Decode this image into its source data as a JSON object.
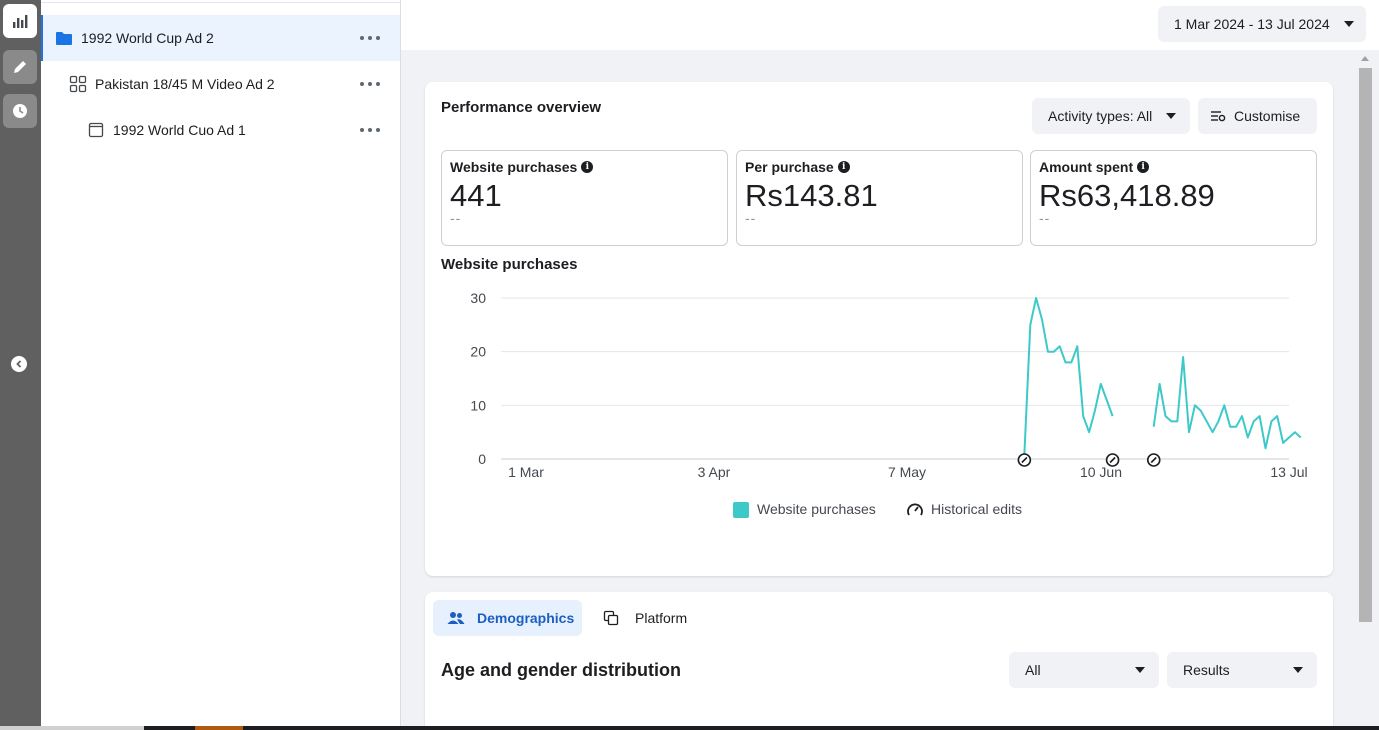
{
  "tree": {
    "items": [
      {
        "label": "1992 World Cup Ad 2",
        "icon": "folder-icon"
      },
      {
        "label": "Pakistan 18/45 M Video Ad 2",
        "icon": "grid-icon"
      },
      {
        "label": "1992 World Cuo Ad 1",
        "icon": "ad-icon"
      }
    ]
  },
  "header": {
    "date_range": "1 Mar 2024 - 13 Jul 2024"
  },
  "performance": {
    "title": "Performance overview",
    "activity_label": "Activity types: All",
    "customise_label": "Customise",
    "metrics": [
      {
        "label": "Website purchases",
        "value": "441",
        "delta": "--"
      },
      {
        "label": "Per purchase",
        "value": "Rs143.81",
        "delta": "--"
      },
      {
        "label": "Amount spent",
        "value": "Rs63,418.89",
        "delta": "--"
      }
    ],
    "chart_title": "Website purchases",
    "legend": {
      "series": "Website purchases",
      "edits": "Historical edits"
    }
  },
  "chart_data": {
    "type": "line",
    "title": "Website purchases",
    "xlabel": "",
    "ylabel": "",
    "ylim": [
      0,
      30
    ],
    "yticks": [
      "0",
      "10",
      "20",
      "30"
    ],
    "xticks": [
      "1 Mar",
      "3 Apr",
      "7 May",
      "10 Jun",
      "13 Jul"
    ],
    "xlim": [
      "2024-03-01",
      "2024-07-13"
    ],
    "grid": true,
    "legend_position": "bottom",
    "colors": {
      "series": "#3dc9c9"
    },
    "series": [
      {
        "name": "Website purchases",
        "segments": [
          [
            [
              "2024-05-29",
              1
            ],
            [
              "2024-05-30",
              25
            ],
            [
              "2024-05-31",
              30
            ],
            [
              "2024-06-01",
              26
            ],
            [
              "2024-06-02",
              20
            ],
            [
              "2024-06-03",
              20
            ],
            [
              "2024-06-04",
              21
            ],
            [
              "2024-06-05",
              18
            ],
            [
              "2024-06-06",
              18
            ],
            [
              "2024-06-07",
              21
            ],
            [
              "2024-06-08",
              8
            ],
            [
              "2024-06-09",
              5
            ],
            [
              "2024-06-10",
              9
            ],
            [
              "2024-06-11",
              14
            ],
            [
              "2024-06-12",
              11
            ],
            [
              "2024-06-13",
              8
            ]
          ],
          [
            [
              "2024-06-20",
              6
            ],
            [
              "2024-06-21",
              14
            ],
            [
              "2024-06-22",
              8
            ],
            [
              "2024-06-23",
              7
            ],
            [
              "2024-06-24",
              7
            ],
            [
              "2024-06-25",
              19
            ],
            [
              "2024-06-26",
              5
            ],
            [
              "2024-06-27",
              10
            ],
            [
              "2024-06-28",
              9
            ],
            [
              "2024-06-29",
              7
            ],
            [
              "2024-06-30",
              5
            ],
            [
              "2024-07-01",
              7
            ],
            [
              "2024-07-02",
              10
            ],
            [
              "2024-07-03",
              6
            ],
            [
              "2024-07-04",
              6
            ],
            [
              "2024-07-05",
              8
            ],
            [
              "2024-07-06",
              4
            ],
            [
              "2024-07-07",
              7
            ],
            [
              "2024-07-08",
              8
            ],
            [
              "2024-07-09",
              2
            ],
            [
              "2024-07-10",
              7
            ],
            [
              "2024-07-11",
              8
            ],
            [
              "2024-07-12",
              3
            ],
            [
              "2024-07-13",
              4
            ],
            [
              "2024-07-14",
              5
            ],
            [
              "2024-07-15",
              4
            ]
          ]
        ]
      }
    ],
    "historical_edits": [
      "2024-05-29",
      "2024-06-13",
      "2024-06-20"
    ]
  },
  "demographics": {
    "tab_demographics": "Demographics",
    "tab_platform": "Platform",
    "title": "Age and gender distribution",
    "filter_all": "All",
    "filter_results": "Results"
  }
}
